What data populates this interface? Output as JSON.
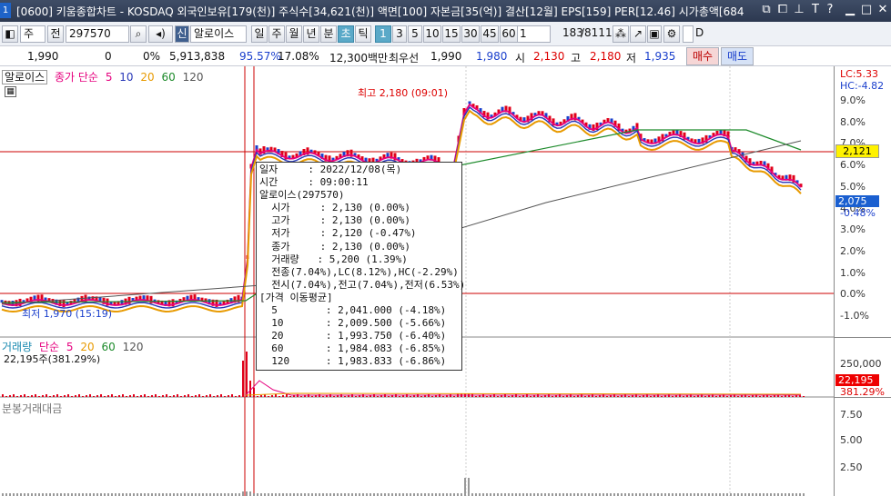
{
  "window": {
    "number": "1",
    "title": "[0600] 키움종합차트 - KOSDAQ 외국인보유[179(천)] 주식수[34,621(천)] 액면[100] 자본금[35(억)] 결산[12월] EPS[159] PER[12.46] 시가총액[684"
  },
  "title_icons": [
    "restore-icon",
    "copy-icon",
    "pin-icon",
    "T",
    "?",
    "minimize-icon",
    "maximize-icon",
    "close-icon"
  ],
  "toolbar": {
    "market": "주",
    "prev_label": "전",
    "code": "297570",
    "name_prefix": "신",
    "stock_name": "알로이스",
    "periods": [
      "일",
      "주",
      "월",
      "년",
      "분",
      "초",
      "틱"
    ],
    "active_period": "초",
    "intervals": [
      "1",
      "3",
      "5",
      "10",
      "15",
      "30",
      "45",
      "60"
    ],
    "active_interval": "1",
    "count": "1",
    "page_current": "183",
    "page_total": "/8111",
    "checkbox_label": "D"
  },
  "quote": {
    "price": "1,990",
    "change": "0",
    "change_rate": "0%",
    "volume": "5,913,838",
    "volume_ratio": "95.57%",
    "turnover": "17.08%",
    "amount": "12,300백만",
    "best_label": "최우선",
    "ask": "1,990",
    "bid": "1,980",
    "open_label": "시",
    "open": "2,130",
    "high_label": "고",
    "high": "2,180",
    "low_label": "저",
    "low": "1,935",
    "buy_label": "매수",
    "sell_label": "매도"
  },
  "price_panel": {
    "stock": "알로이스",
    "indicator": "종가 단순",
    "ma_periods": [
      "5",
      "10",
      "20",
      "60",
      "120"
    ],
    "ma_colors": [
      "#e6007e",
      "#2838b8",
      "#e89a00",
      "#1c8a2a",
      "#555555"
    ],
    "lc": "LC:5.33",
    "hc": "HC:-4.82",
    "ylabels": [
      "9.0%",
      "8.0%",
      "7.0%",
      "6.0%",
      "5.0%",
      "4.0%",
      "3.0%",
      "2.0%",
      "1.0%",
      "0.0%",
      "-1.0%"
    ],
    "current_price_tag": "2,121",
    "current_value_tag": "2,075",
    "current_pct": "-0.48%",
    "high_annotation": "최고 2,180 (09:01)",
    "low_annotation": "최저 1,970 (15:19)"
  },
  "volume_panel": {
    "title": "거래량",
    "indicator": "단순",
    "ma_periods": [
      "5",
      "20",
      "60",
      "120"
    ],
    "ma_colors": [
      "#e6007e",
      "#e89a00",
      "#1c8a2a",
      "#555555"
    ],
    "current": "22,195주(381.29%)",
    "ylabel": "250,000",
    "tag_value": "22,195",
    "tag_pct": "381.29%"
  },
  "amount_panel": {
    "title": "분봉거래대금",
    "ylabels": [
      "7.50",
      "5.00",
      "2.50"
    ]
  },
  "tooltip": {
    "rows": [
      "일자     : 2022/12/08(목)",
      "시간     : 09:00:11",
      "알로이스(297570)",
      "  시가     : 2,130 (0.00%)",
      "  고가     : 2,130 (0.00%)",
      "  저가     : 2,120 (-0.47%)",
      "  종가     : 2,130 (0.00%)",
      "  거래량   : 5,200 (1.39%)",
      "  전종(7.04%),LC(8.12%),HC(-2.29%)",
      "  전시(7.04%),전고(7.04%),전저(6.53%)",
      "[가격 이동평균]",
      "  5        : 2,041.000 (-4.18%)",
      "  10       : 2,009.500 (-5.66%)",
      "  20       : 1,993.750 (-6.40%)",
      "  60       : 1,984.083 (-6.85%)",
      "  120      : 1,983.833 (-6.86%)"
    ]
  }
}
